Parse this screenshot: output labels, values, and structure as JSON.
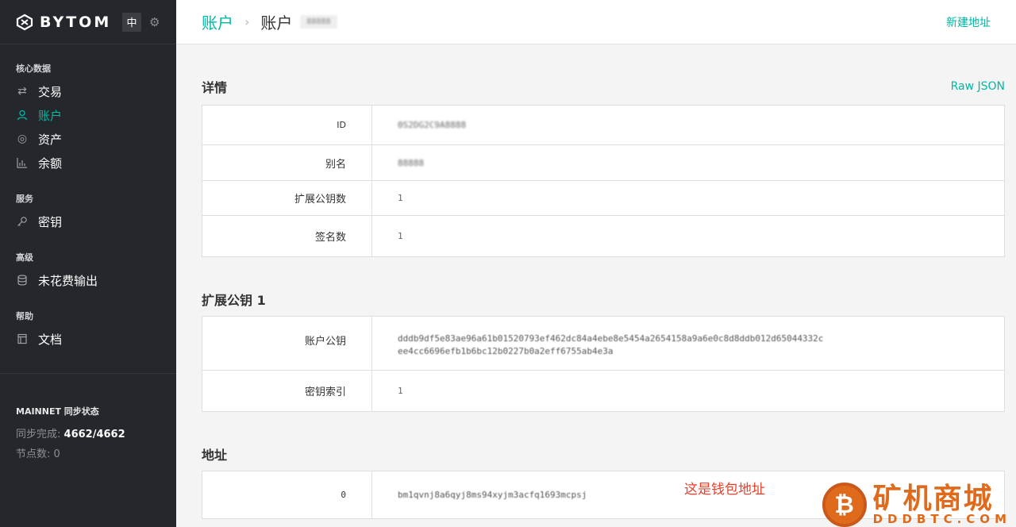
{
  "sidebar": {
    "brand": "BYTOM",
    "lang_button": "中",
    "sections": [
      {
        "heading": "核心数据",
        "items": [
          "交易",
          "账户",
          "资产",
          "余额"
        ]
      },
      {
        "heading": "服务",
        "items": [
          "密钥"
        ]
      },
      {
        "heading": "高级",
        "items": [
          "未花费输出"
        ]
      },
      {
        "heading": "帮助",
        "items": [
          "文档"
        ]
      }
    ],
    "active_item": "账户",
    "sync": {
      "title": "MAINNET 同步状态",
      "progress_label": "同步完成:",
      "progress_value": "4662/4662",
      "peers_label": "节点数:",
      "peers_value": "0"
    }
  },
  "header": {
    "crumb_parent": "账户",
    "crumb_separator": "›",
    "crumb_current": "账户",
    "crumb_tag": "88888",
    "action": "新建地址"
  },
  "details": {
    "title": "详情",
    "raw_json": "Raw JSON",
    "rows": [
      {
        "key": "ID",
        "value": "0S2DG2C9A8888"
      },
      {
        "key": "别名",
        "value": "88888"
      },
      {
        "key": "扩展公钥数",
        "value": "1"
      },
      {
        "key": "签名数",
        "value": "1"
      }
    ]
  },
  "xpub": {
    "title": "扩展公钥 1",
    "rows": [
      {
        "key": "账户公钥",
        "value_line1": "dddb9df5e83ae96a61b01520793ef462dc84a4ebe8e5454a2654158a9a6e0c8d8ddb012d65044332c",
        "value_line2": "ee4cc6696efb1b6bc12b0227b0a2eff6755ab4e3a"
      },
      {
        "key": "密钥索引",
        "value": "1"
      }
    ]
  },
  "address": {
    "title": "地址",
    "rows": [
      {
        "key": "0",
        "value": "bm1qvnj8a6qyj8ms94xyjm3acfq1693mcpsj"
      }
    ]
  },
  "annotation": "这是钱包地址",
  "watermark": {
    "cn": "矿机商城",
    "en": "DDDBTC.COM"
  },
  "colors": {
    "accent": "#00b8a3",
    "sidebar_bg": "#24272c",
    "annotation": "#e8402b"
  }
}
